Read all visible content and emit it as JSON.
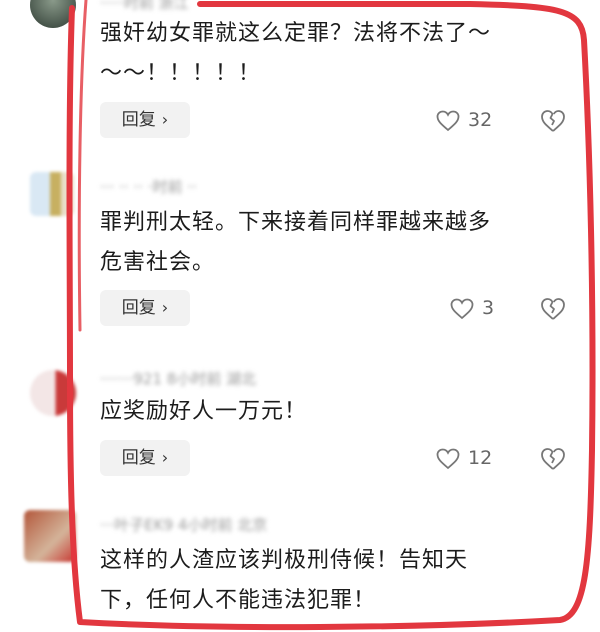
{
  "comments": [
    {
      "meta": "·····时前 浙江",
      "text_lines": [
        "强奸幼女罪就这么定罪？法将不法了～",
        "～～！！！！！"
      ],
      "reply_label": "回复",
      "like_count": "32"
    },
    {
      "meta": "··· ·· ·· ·时前 ··",
      "text_lines": [
        "罪判刑太轻。下来接着同样罪越来越多",
        "危害社会。"
      ],
      "reply_label": "回复",
      "like_count": "3"
    },
    {
      "meta": "·······921 8小时前 湖北",
      "text_lines": [
        "应奖励好人一万元！"
      ],
      "reply_label": "回复",
      "like_count": "12"
    },
    {
      "meta": "···叶子EK9 4小时前 北京",
      "text_lines": [
        "这样的人渣应该判极刑侍候！告知天",
        "下，任何人不能违法犯罪！"
      ]
    }
  ],
  "colors": {
    "annotation_red": "#e2373f",
    "reply_bg": "#f2f2f2"
  }
}
